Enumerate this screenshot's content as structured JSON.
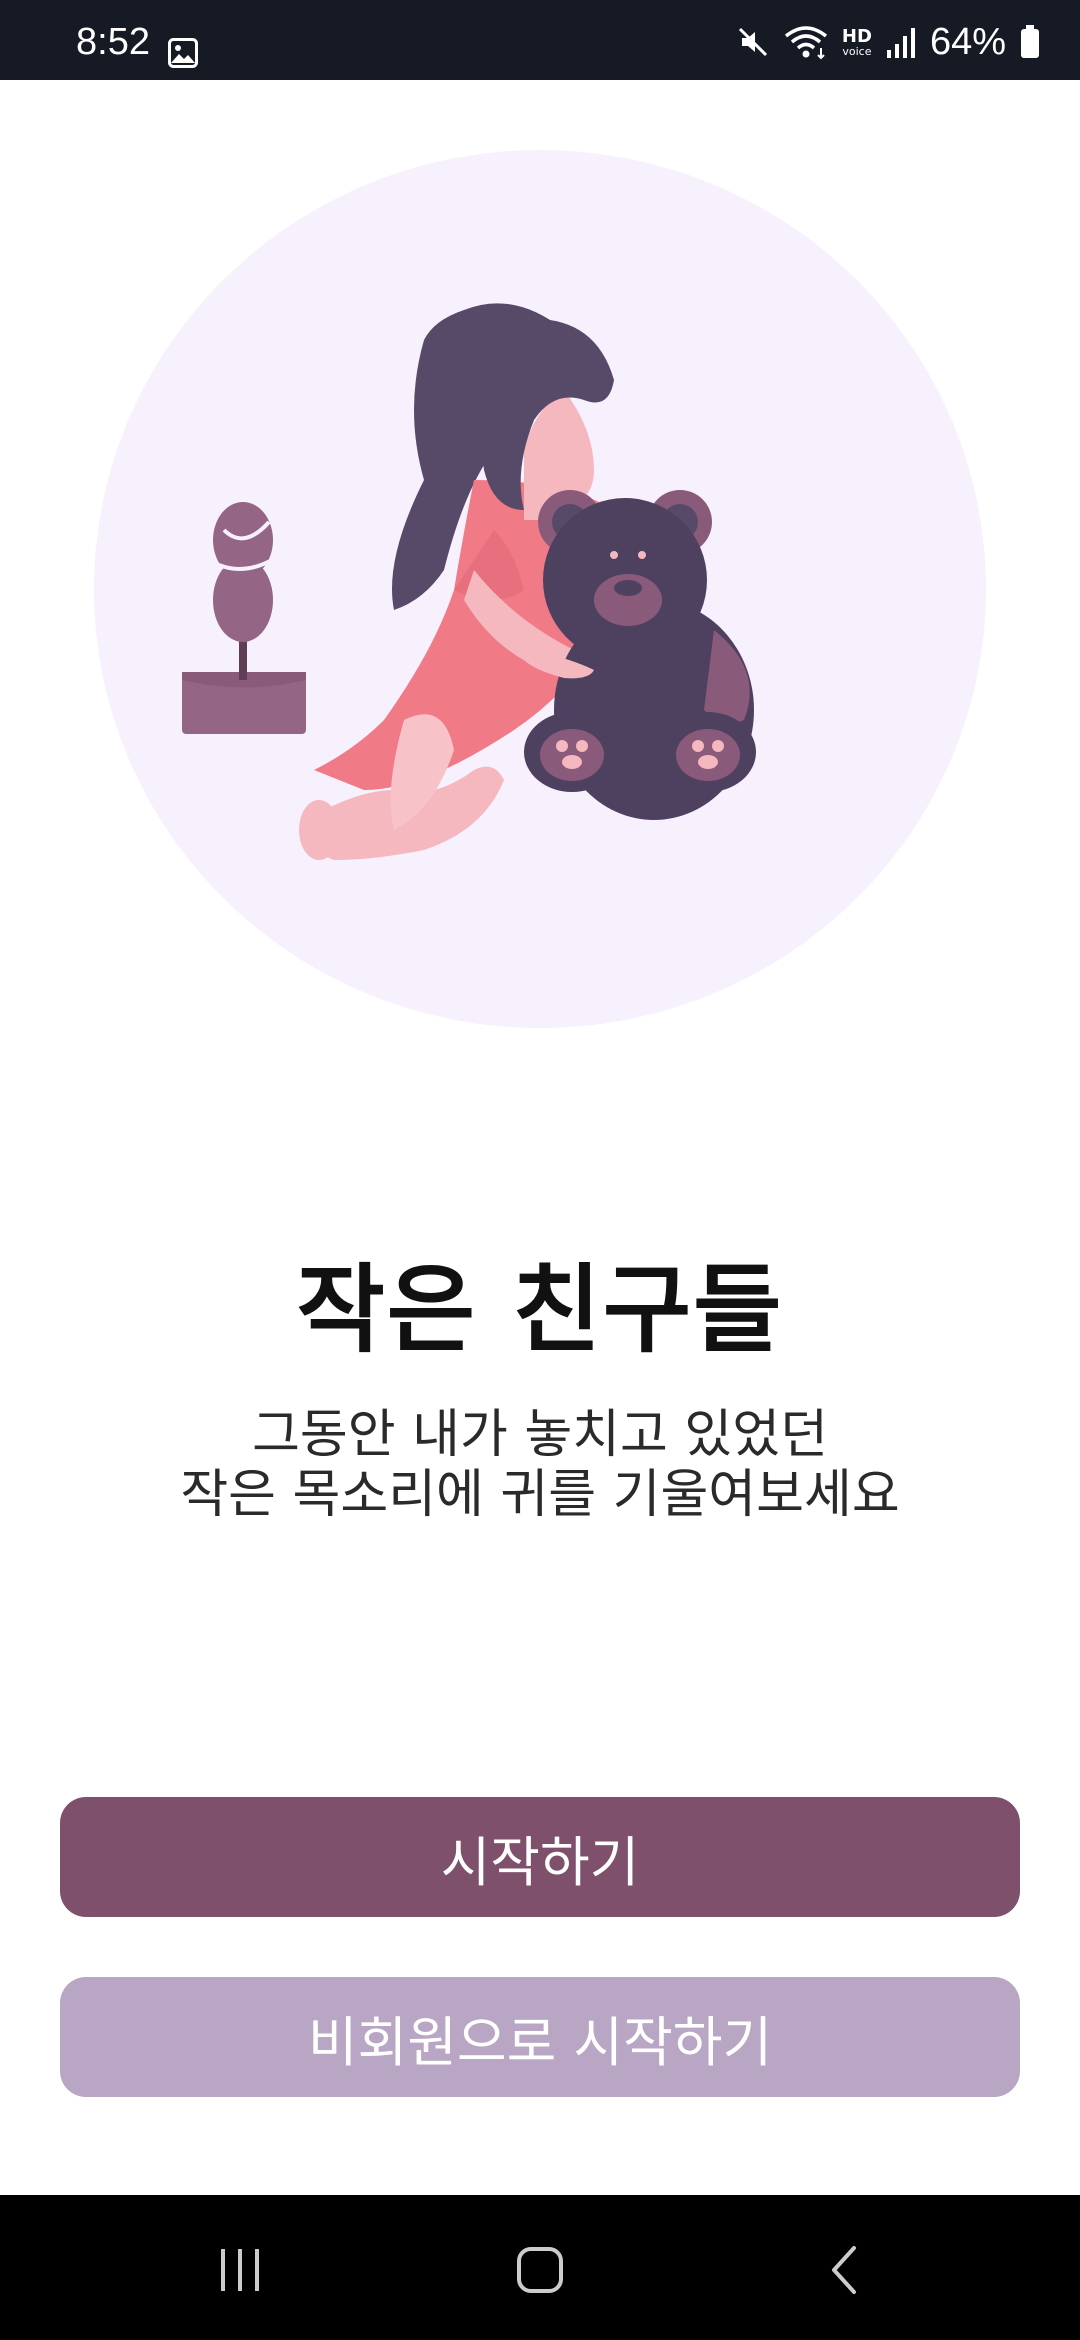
{
  "status_bar": {
    "time": "8:52",
    "battery_percent": "64%",
    "hd_label": "HD",
    "voice_label": "voice",
    "icons": [
      "gallery-icon",
      "mute-icon",
      "wifi-icon",
      "hd-voice-icon",
      "signal-icon",
      "battery-icon"
    ]
  },
  "hero": {
    "illustration": "girl-hugging-teddy-bear-illustration",
    "circle_color": "#f7f0fd"
  },
  "main": {
    "title": "작은 친구들",
    "subtitle_line1": "그동안 내가 놓치고 있었던",
    "subtitle_line2": "작은 목소리에 귀를 기울여보세요"
  },
  "buttons": {
    "start_label": "시작하기",
    "guest_start_label": "비회원으로 시작하기",
    "start_color": "#7e506b",
    "guest_color": "#b8a6c4"
  },
  "nav_bar": {
    "icons": [
      "recent-apps-icon",
      "home-icon",
      "back-icon"
    ]
  }
}
